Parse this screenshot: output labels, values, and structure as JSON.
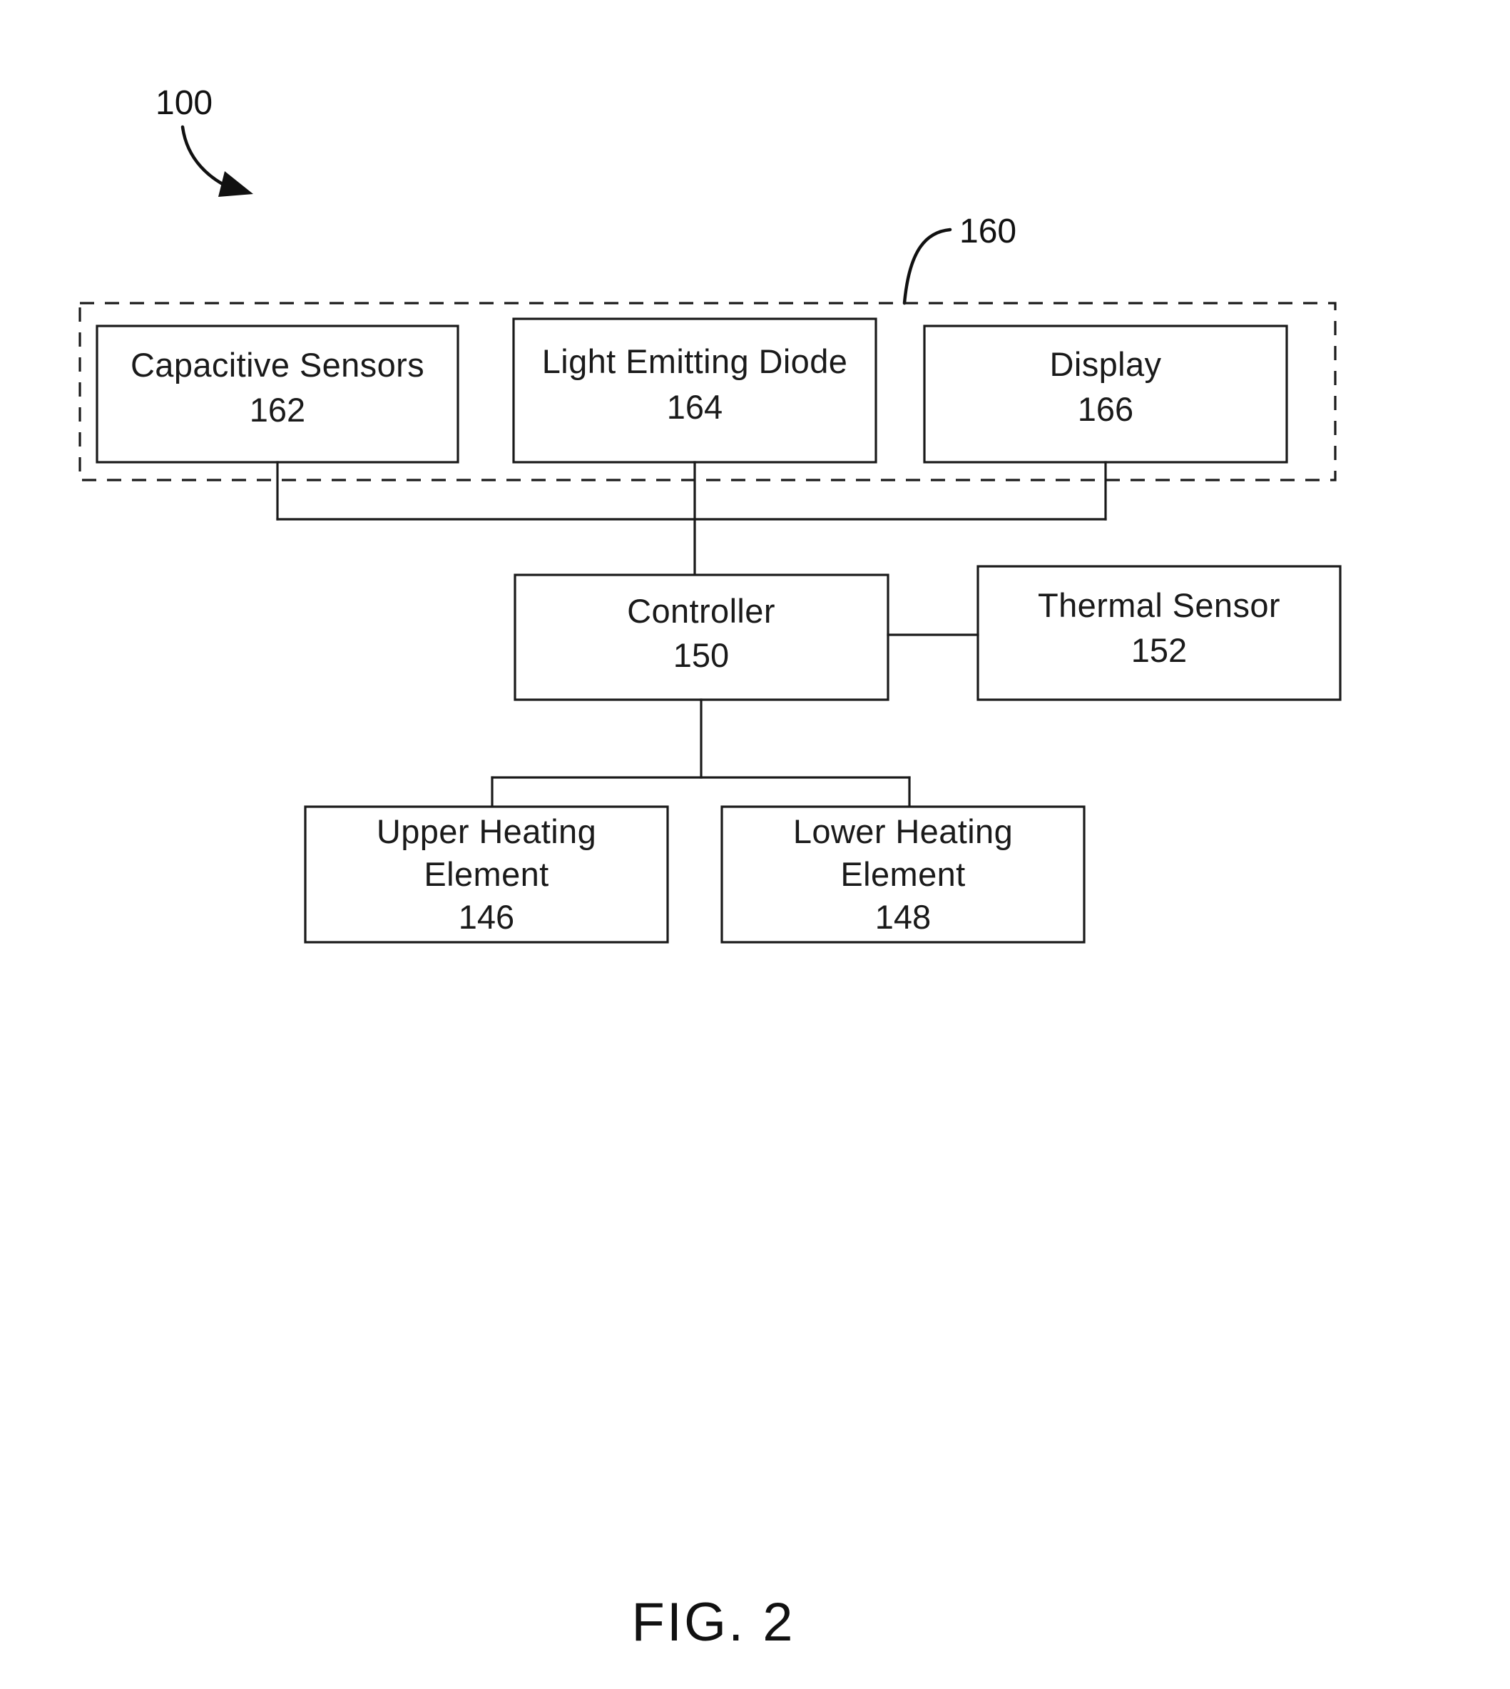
{
  "figure": {
    "caption": "FIG. 2",
    "system_reference": "100",
    "group_reference": "160"
  },
  "blocks": [
    {
      "id": "capacitive-sensors",
      "lines": [
        "Capacitive Sensors"
      ],
      "ref": "162"
    },
    {
      "id": "light-emitting-diode",
      "lines": [
        "Light Emitting Diode"
      ],
      "ref": "164"
    },
    {
      "id": "display",
      "lines": [
        "Display"
      ],
      "ref": "166"
    },
    {
      "id": "controller",
      "lines": [
        "Controller"
      ],
      "ref": "150"
    },
    {
      "id": "thermal-sensor",
      "lines": [
        "Thermal Sensor"
      ],
      "ref": "152"
    },
    {
      "id": "upper-heating-element",
      "lines": [
        "Upper Heating",
        "Element"
      ],
      "ref": "146"
    },
    {
      "id": "lower-heating-element",
      "lines": [
        "Lower Heating",
        "Element"
      ],
      "ref": "148"
    }
  ],
  "colors": {
    "stroke": "#1a1a1a",
    "background": "#ffffff",
    "text": "#111111"
  }
}
